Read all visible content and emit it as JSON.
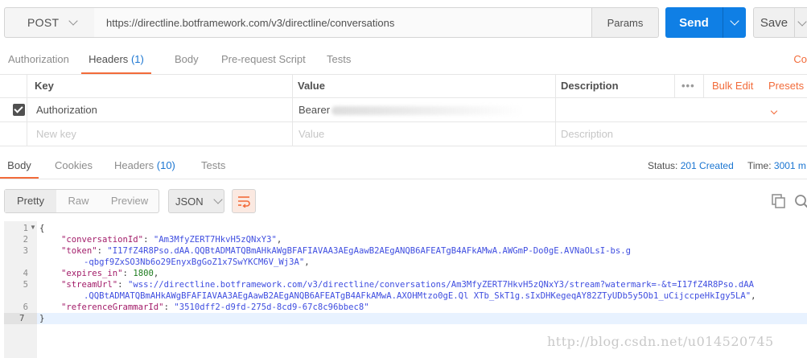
{
  "request": {
    "method": "POST",
    "url": "https://directline.botframework.com/v3/directline/conversations",
    "params_label": "Params",
    "send_label": "Send",
    "save_label": "Save"
  },
  "tabs": [
    {
      "label": "Authorization"
    },
    {
      "label": "Headers",
      "count": "(1)"
    },
    {
      "label": "Body"
    },
    {
      "label": "Pre-request Script"
    },
    {
      "label": "Tests"
    }
  ],
  "tabs_right_label": "Co",
  "headers_table": {
    "col_key": "Key",
    "col_value": "Value",
    "col_description": "Description",
    "more_label": "•••",
    "bulk_edit_label": "Bulk Edit",
    "presets_label": "Presets",
    "rows": [
      {
        "checked": true,
        "key": "Authorization",
        "value": "Bearer"
      }
    ],
    "new_key_placeholder": "New key",
    "new_value_placeholder": "Value",
    "new_description_placeholder": "Description"
  },
  "response": {
    "tabs": [
      {
        "label": "Body"
      },
      {
        "label": "Cookies"
      },
      {
        "label": "Headers",
        "count": "(10)"
      },
      {
        "label": "Tests"
      }
    ],
    "status_label": "Status:",
    "status_value": "201 Created",
    "time_label": "Time:",
    "time_value": "3001 m",
    "view_modes": [
      "Pretty",
      "Raw",
      "Preview"
    ],
    "format": "JSON"
  },
  "code_lines": [
    {
      "n": "1",
      "fold": true,
      "text": "{"
    },
    {
      "n": "2",
      "key": "\"conversationId\"",
      "val": "\"Am3MfyZERT7HkvH5zQNxY3\"",
      "end": ","
    },
    {
      "n": "3",
      "key": "\"token\"",
      "val": "\"I17fZ4R8Pso.dAA.QQBtADMATQBmAHkAWgBFAFIAVAA3AEgAawB2AEgANQB6AFEATgB4AFkAMwA.AWGmP-Do0gE.AVNaOLsI-bs.g",
      "end": ""
    },
    {
      "n": "",
      "cont": "-qbgf9ZxSO3Nb6o29EnyxBgGoZ1x7SwYKCM6V_Wj3A\"",
      "end": ","
    },
    {
      "n": "4",
      "key": "\"expires_in\"",
      "num": "1800",
      "end": ","
    },
    {
      "n": "5",
      "key": "\"streamUrl\"",
      "val": "\"wss://directline.botframework.com/v3/directline/conversations/Am3MfyZERT7HkvH5zQNxY3/stream?watermark=-&t=I17fZ4R8Pso.dAA",
      "end": ""
    },
    {
      "n": "",
      "cont": ".QQBtADMATQBmAHkAWgBFAFIAVAA3AEgAawB2AEgANQB6AFEATgB4AFkAMwA.AXOHMtzo0gE.Ql XTb_SkT1g.sIxDHKegeqAY82ZTyUDb5y5Ob1_uCijccpeHkIgy5LA\"",
      "end": ","
    },
    {
      "n": "6",
      "key": "\"referenceGrammarId\"",
      "val": "\"3510dff2-d9fd-275d-8cd9-67c8c96bbec8\"",
      "end": ""
    },
    {
      "n": "7",
      "text": "}"
    }
  ],
  "watermark": "http://blog.csdn.net/u014520745"
}
